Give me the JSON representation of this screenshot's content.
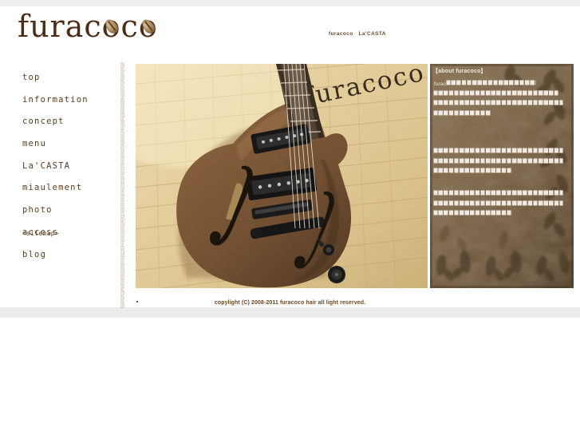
{
  "site": {
    "logo_text": "furacoco",
    "logo_color": "#4a2c17"
  },
  "header": {
    "links": [
      {
        "label": "furacoco"
      },
      {
        "label": "La'CASTA"
      }
    ]
  },
  "sidebar": {
    "items": [
      {
        "label": "top"
      },
      {
        "label": "information"
      },
      {
        "label": "concept"
      },
      {
        "label": "menu"
      },
      {
        "label": "La'CASTA"
      },
      {
        "label": "miaulement"
      },
      {
        "label": "photo"
      },
      {
        "label": "access"
      },
      {
        "label": "blog"
      }
    ],
    "sitemap_label": "<sitemap>"
  },
  "main": {
    "hero_image": {
      "alt": "semi-hollow electric guitar leaning against a cream brick wall",
      "wall_sign_text": "furacoco"
    }
  },
  "about": {
    "title": "【about furacoco】",
    "lead_prefix": "furacoco",
    "paragraphs": [
      {
        "lines": [
          24,
          24,
          25,
          11
        ]
      },
      {
        "lines": [
          25,
          25,
          15
        ]
      },
      {
        "lines": [
          25,
          25,
          15
        ]
      }
    ]
  },
  "footer": {
    "copyright": "copylight (C) 2008-2011 furacoco hair all light reserved."
  },
  "colors": {
    "page_background": "#ffffff",
    "outer_background": "#eeeeee",
    "text_brown": "#5a3c20",
    "accent_brown": "#6b4520",
    "panel_brown": "#6d573f"
  }
}
